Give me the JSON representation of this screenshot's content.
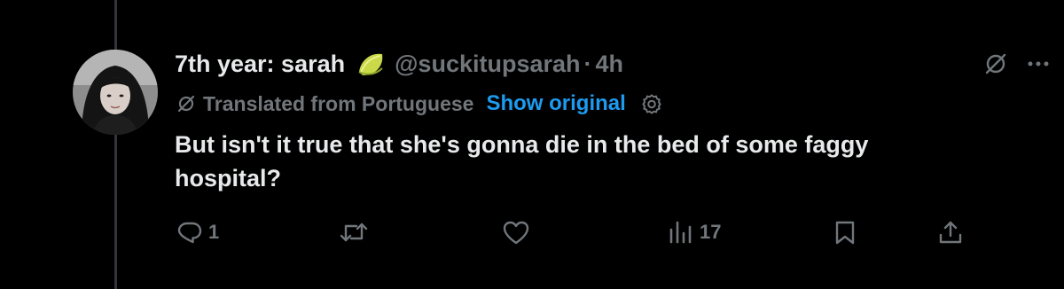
{
  "tweet": {
    "display_name": "7th year: sarah",
    "handle": "@suckitupsarah",
    "separator": "·",
    "time": "4h",
    "emoji": "lime-icon",
    "translation_note": "Translated from Portuguese",
    "show_original_label": "Show original",
    "text": "But isn't it true that she's gonna die in the bed of some faggy\nhospital?"
  },
  "actions": {
    "reply_count": "1",
    "retweet_count": "",
    "like_count": "",
    "views_count": "17"
  },
  "colors": {
    "background": "#000000",
    "text_primary": "#e7e9ea",
    "text_secondary": "#71767b",
    "link_blue": "#1d9bf0",
    "thread_line": "#333639"
  }
}
